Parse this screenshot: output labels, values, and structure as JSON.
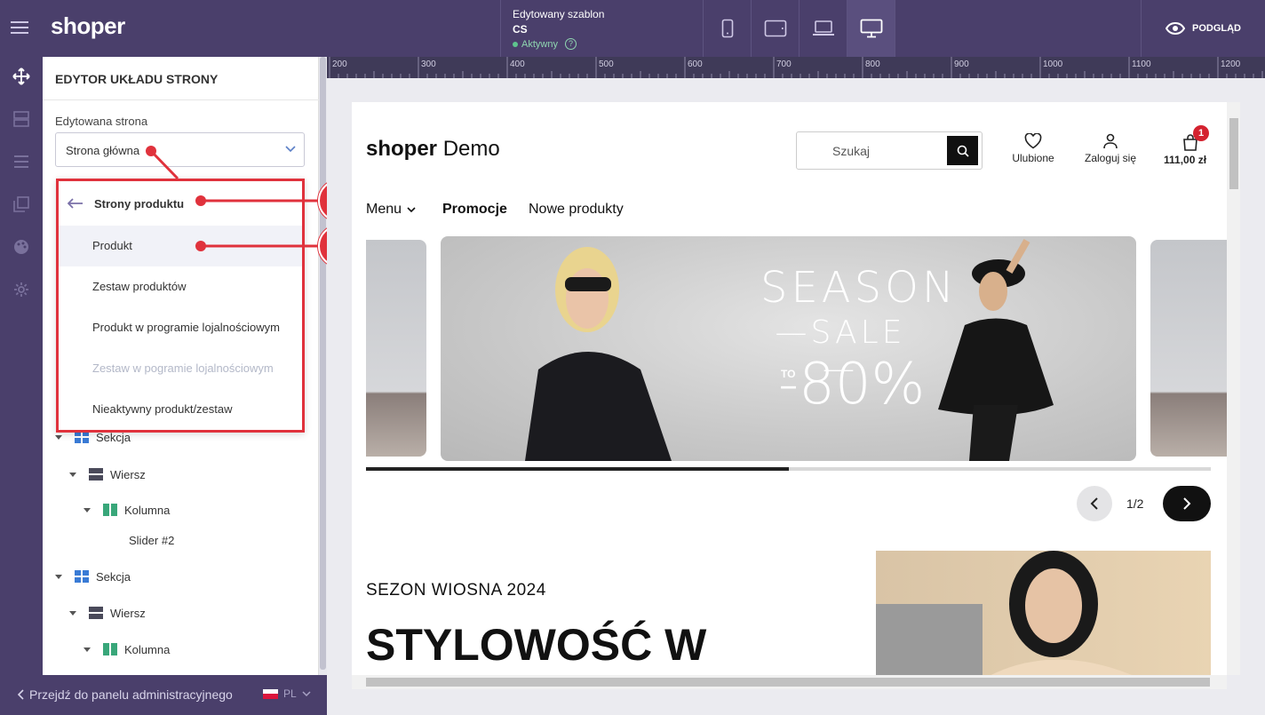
{
  "topbar": {
    "logo": "shoper",
    "template": {
      "title": "Edytowany szablon",
      "code": "CS",
      "status": "Aktywny",
      "help": "?"
    },
    "devices": [
      "mobile-icon",
      "tablet-icon",
      "laptop-icon",
      "desktop-icon"
    ],
    "active_device": "desktop",
    "preview_label": "PODGLĄD"
  },
  "rail": {
    "icons": [
      "move-icon",
      "layout-icon",
      "rows-icon",
      "pages-icon",
      "palette-icon",
      "gear-icon"
    ]
  },
  "sidebar": {
    "title": "EDYTOR UKŁADU STRONY",
    "edited_label": "Edytowana strona",
    "edited_value": "Strona główna",
    "dropdown": {
      "back_label": "Strony produktu",
      "items": [
        {
          "label": "Produkt",
          "state": "hover"
        },
        {
          "label": "Zestaw produktów",
          "state": "normal"
        },
        {
          "label": "Produkt w programie lojalnościowym",
          "state": "normal"
        },
        {
          "label": "Zestaw w pogramie lojalnościowym",
          "state": "disabled"
        },
        {
          "label": "Nieaktywny produkt/zestaw",
          "state": "normal"
        }
      ]
    },
    "tree": [
      {
        "type": "section",
        "label": "Sekcja"
      },
      {
        "type": "row",
        "label": "Wiersz"
      },
      {
        "type": "column",
        "label": "Kolumna"
      },
      {
        "type": "module",
        "label": "Slider #2"
      },
      {
        "type": "section",
        "label": "Sekcja"
      },
      {
        "type": "row",
        "label": "Wiersz"
      },
      {
        "type": "column",
        "label": "Kolumna"
      }
    ]
  },
  "bottombar": {
    "admin_link": "Przejdź do panelu administracyjnego",
    "lang": "PL"
  },
  "ruler": {
    "ticks": [
      "200",
      "300",
      "400",
      "500",
      "600",
      "700",
      "800",
      "900",
      "1000",
      "1100",
      "1200"
    ]
  },
  "store": {
    "logo_bold": "shoper",
    "logo_rest": "Demo",
    "search_placeholder": "Szukaj",
    "favorites": "Ulubione",
    "login": "Zaloguj się",
    "cart_total": "111,00 zł",
    "cart_count": "1",
    "nav": {
      "menu": "Menu",
      "promo": "Promocje",
      "new": "Nowe produkty"
    },
    "banner": {
      "line1": "SEASON",
      "line2": "—SALE—",
      "to": "TO",
      "percent": "-80%"
    },
    "slider_progress": 0.5,
    "pager": "1/2",
    "season_label": "SEZON WIOSNA 2024",
    "headline": "STYLOWOŚĆ W"
  },
  "annotations": {
    "a": "A",
    "b": "B"
  },
  "colors": {
    "brand": "#4a3f6b",
    "annotation": "#e0323c",
    "badge": "#d4222f"
  }
}
